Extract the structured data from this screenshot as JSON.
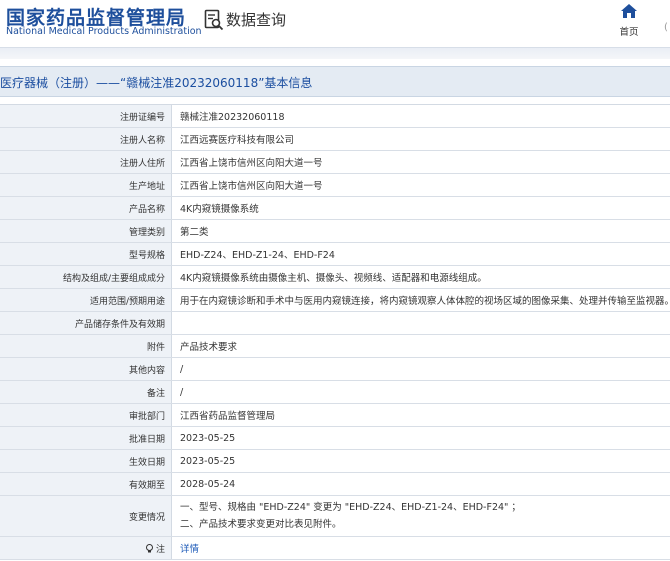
{
  "header": {
    "org_name_cn": "国家药品监督管理局",
    "org_name_en": "National Medical Products Administration",
    "query_title": "数据查询",
    "home_label": "首页",
    "right_text": "("
  },
  "page": {
    "title": "医疗器械（注册）——“赣械注准20232060118”基本信息"
  },
  "table": {
    "rows": [
      {
        "label": "注册证编号",
        "value": "赣械注准20232060118"
      },
      {
        "label": "注册人名称",
        "value": "江西远赛医疗科技有限公司"
      },
      {
        "label": "注册人住所",
        "value": "江西省上饶市信州区向阳大道一号"
      },
      {
        "label": "生产地址",
        "value": "江西省上饶市信州区向阳大道一号"
      },
      {
        "label": "产品名称",
        "value": "4K内窥镜摄像系统"
      },
      {
        "label": "管理类别",
        "value": "第二类"
      },
      {
        "label": "型号规格",
        "value": "EHD-Z24、EHD-Z1-24、EHD-F24"
      },
      {
        "label": "结构及组成/主要组成成分",
        "value": "4K内窥镜摄像系统由摄像主机、摄像头、视频线、适配器和电源线组成。"
      },
      {
        "label": "适用范围/预期用途",
        "value": "用于在内窥镜诊断和手术中与医用内窥镜连接，将内窥镜观察人体体腔的视场区域的图像采集、处理并传输至监视器。"
      },
      {
        "label": "产品储存条件及有效期",
        "value": ""
      },
      {
        "label": "附件",
        "value": "产品技术要求"
      },
      {
        "label": "其他内容",
        "value": "/"
      },
      {
        "label": "备注",
        "value": "/"
      },
      {
        "label": "审批部门",
        "value": "江西省药品监督管理局"
      },
      {
        "label": "批准日期",
        "value": "2023-05-25"
      },
      {
        "label": "生效日期",
        "value": "2023-05-25"
      },
      {
        "label": "有效期至",
        "value": "2028-05-24"
      }
    ],
    "change_label": "变更情况",
    "change_line1": "一、型号、规格由 \"EHD-Z24\" 变更为 \"EHD-Z24、EHD-Z1-24、EHD-F24\" ；",
    "change_line2": "二、产品技术要求变更对比表见附件。",
    "note_label": "注",
    "note_link": "详情"
  },
  "colors": {
    "brand_blue": "#1e4f9c",
    "label_bg": "#eef2f7",
    "title_bar_bg": "#e4ebf3",
    "link": "#1e5bb8"
  }
}
